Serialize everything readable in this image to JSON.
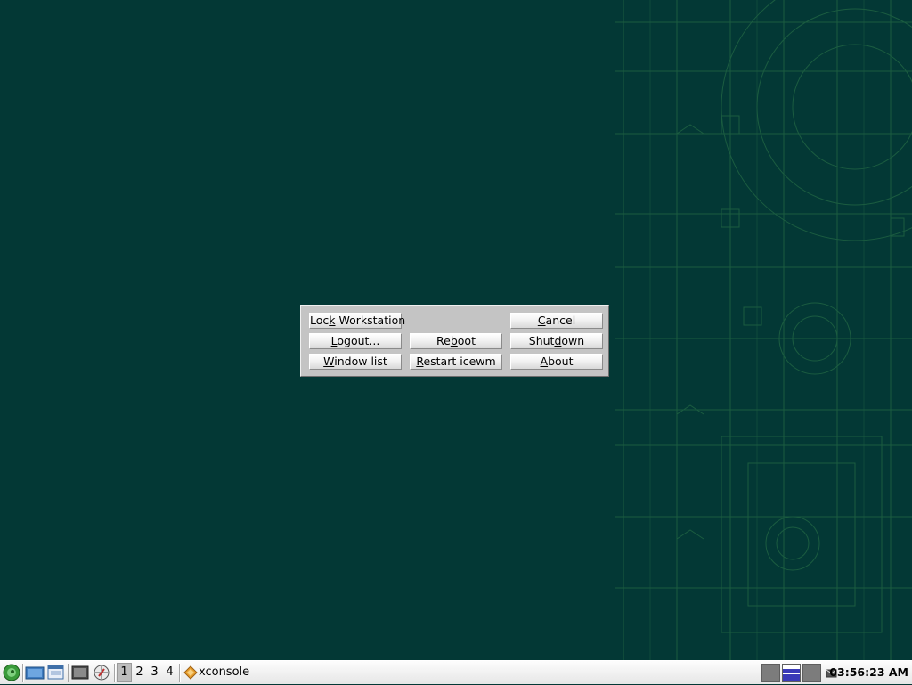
{
  "dialog": {
    "buttons": {
      "lock_workstation": {
        "pre": "Loc",
        "key": "k",
        "post": " Workstation"
      },
      "cancel": {
        "pre": "",
        "key": "C",
        "post": "ancel"
      },
      "logout": {
        "pre": "",
        "key": "L",
        "post": "ogout..."
      },
      "reboot": {
        "pre": "Re",
        "key": "b",
        "post": "oot"
      },
      "shutdown": {
        "pre": "Shut",
        "key": "d",
        "post": "own"
      },
      "window_list": {
        "pre": "",
        "key": "W",
        "post": "indow list"
      },
      "restart_icewm": {
        "pre": "",
        "key": "R",
        "post": "estart icewm"
      },
      "about": {
        "pre": "",
        "key": "A",
        "post": "bout"
      }
    }
  },
  "taskbar": {
    "workspaces": [
      "1",
      "2",
      "3",
      "4"
    ],
    "active_workspace": "1",
    "task": {
      "label": "xconsole",
      "icon": "xconsole-icon"
    },
    "clock": "03:56:23 AM",
    "launchers": [
      "start-menu-icon",
      "file-manager-icon",
      "window-list-icon",
      "terminal-icon",
      "browser-icon"
    ]
  },
  "colors": {
    "desktop": "#033835",
    "wallpaper_lines": "#2f7a4a",
    "dialog_bg": "#c4c4c4",
    "pager_active": "#3a3ab8"
  }
}
